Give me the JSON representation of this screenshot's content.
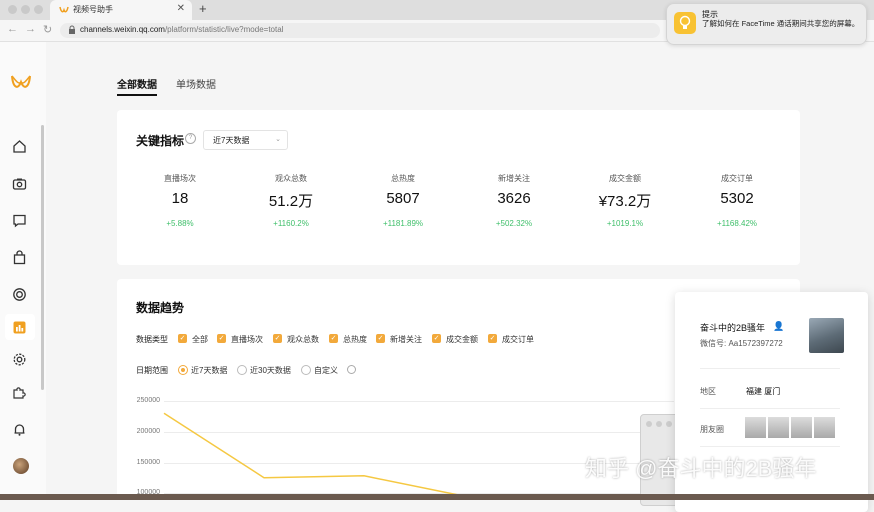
{
  "browser": {
    "tab_title": "视频号助手",
    "url_host": "channels.weixin.qq.com",
    "url_path": "/platform/statistic/live?mode=total"
  },
  "notification": {
    "title": "提示",
    "body": "了解如何在 FaceTime 通话期间共享您的屏幕。"
  },
  "sidebar": {
    "items": [
      "home-icon",
      "camera-icon",
      "message-icon",
      "bag-icon",
      "circle-icon",
      "chart-icon",
      "settings-icon",
      "puzzle-icon",
      "bell-icon"
    ],
    "active": "chart-icon"
  },
  "tabs": [
    {
      "label": "全部数据",
      "active": true
    },
    {
      "label": "单场数据",
      "active": false
    }
  ],
  "key_metrics": {
    "title": "关键指标",
    "period_select": "近7天数据",
    "items": [
      {
        "label": "直播场次",
        "value": "18",
        "change": "+5.88%"
      },
      {
        "label": "观众总数",
        "value": "51.2万",
        "change": "+1160.2%"
      },
      {
        "label": "总热度",
        "value": "5807",
        "change": "+1181.89%"
      },
      {
        "label": "新增关注",
        "value": "3626",
        "change": "+502.32%"
      },
      {
        "label": "成交金额",
        "value": "¥73.2万",
        "change": "+1019.1%"
      },
      {
        "label": "成交订单",
        "value": "5302",
        "change": "+1168.42%"
      }
    ]
  },
  "trend": {
    "title": "数据趋势",
    "type_label": "数据类型",
    "checkboxes": [
      "全部",
      "直播场次",
      "观众总数",
      "总热度",
      "新增关注",
      "成交金额",
      "成交订单"
    ],
    "range_label": "日期范围",
    "ranges": [
      {
        "label": "近7天数据",
        "selected": true
      },
      {
        "label": "近30天数据",
        "selected": false
      },
      {
        "label": "自定义",
        "selected": false
      }
    ]
  },
  "chart_data": {
    "type": "line",
    "y_ticks": [
      "250000",
      "200000",
      "150000",
      "100000"
    ],
    "ylim": [
      100000,
      250000
    ],
    "series": [
      {
        "color": "#f5c842",
        "values": [
          230000,
          125000,
          128000,
          95000
        ]
      },
      {
        "color": "#4a5adb",
        "values": [
          95000,
          95000,
          95000,
          95000
        ]
      }
    ]
  },
  "profile": {
    "name": "奋斗中的2B骚年",
    "wechat_id": "微信号: Aa1572397272",
    "region_label": "地区",
    "region_value": "福建 厦门",
    "moments_label": "朋友圈"
  },
  "watermark": "知乎 @奋斗中的2B骚年"
}
